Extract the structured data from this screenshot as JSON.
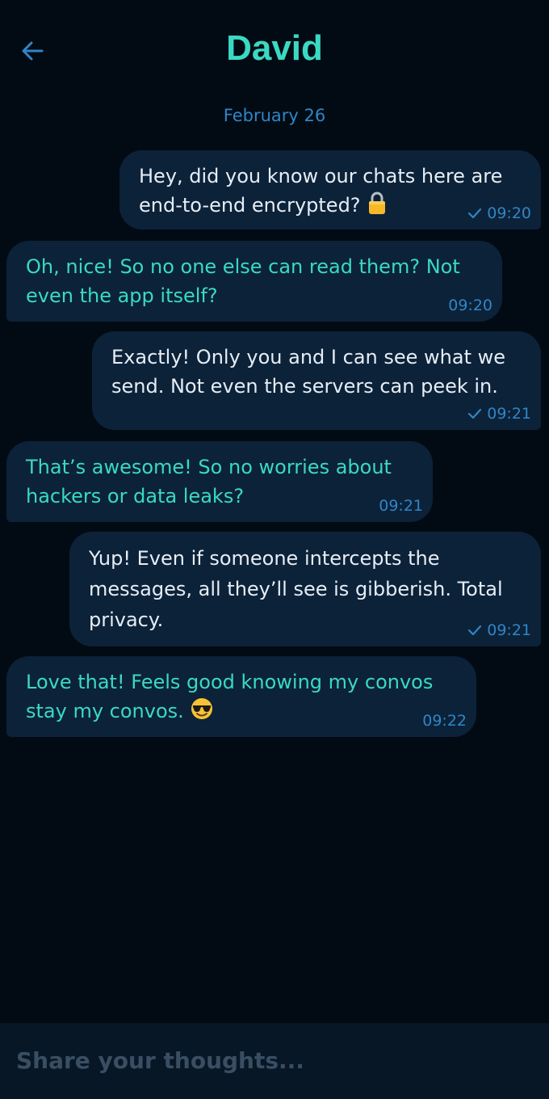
{
  "header": {
    "contact_name": "David",
    "back_icon": "arrow-left-icon"
  },
  "date_separator": "February 26",
  "messages": [
    {
      "direction": "out",
      "text": "Hey, did you know our chats here are end-to-end encrypted?",
      "emoji": "lock",
      "time": "09:20",
      "status": "sent"
    },
    {
      "direction": "in",
      "text": "Oh, nice! So no one else can read them? Not even the app itself?",
      "time": "09:20"
    },
    {
      "direction": "out",
      "text": "Exactly! Only you and I can see what we send. Not even the servers can peek in.",
      "time": "09:21",
      "status": "sent"
    },
    {
      "direction": "in",
      "text": "That’s awesome! So no worries about hackers or data leaks?",
      "time": "09:21"
    },
    {
      "direction": "out",
      "text": "Yup! Even if someone intercepts the messages, all they’ll see is gibberish. Total privacy.",
      "time": "09:21",
      "status": "sent"
    },
    {
      "direction": "in",
      "text": "Love that! Feels good knowing my convos stay my convos.",
      "emoji": "smiling-face-with-sunglasses",
      "time": "09:22"
    }
  ],
  "composer": {
    "placeholder": "Share your thoughts..."
  },
  "colors": {
    "background": "#020b14",
    "bubble": "#0c2239",
    "accent": "#3ad9c3",
    "meta": "#2f86c6",
    "composer": "#071726"
  }
}
